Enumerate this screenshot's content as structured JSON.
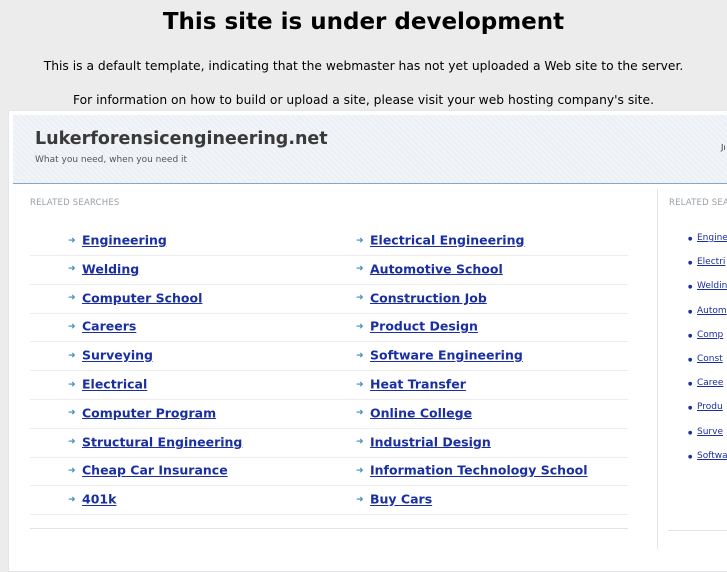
{
  "notice": {
    "title": "This site is under development",
    "line1": "This is a default template, indicating that the webmaster has not yet uploaded a Web site to the server.",
    "line2": "For information on how to build or upload a site, please visit your web hosting company's site."
  },
  "header": {
    "site_title": "Lukerforensicengineering.net",
    "tagline": "What you need, when you need it",
    "right_fragment": "Jı"
  },
  "main": {
    "section_label": "RELATED SEARCHES",
    "rows": [
      [
        "Engineering",
        "Electrical Engineering"
      ],
      [
        "Welding",
        "Automotive School"
      ],
      [
        "Computer School",
        "Construction Job"
      ],
      [
        "Careers",
        "Product Design"
      ],
      [
        "Surveying",
        "Software Engineering"
      ],
      [
        "Electrical",
        "Heat Transfer"
      ],
      [
        "Computer Program",
        "Online College"
      ],
      [
        "Structural Engineering",
        "Industrial Design"
      ],
      [
        "Cheap Car Insurance",
        "Information Technology School"
      ],
      [
        "401k",
        "Buy Cars"
      ]
    ]
  },
  "side": {
    "section_label": "RELATED SEA",
    "items": [
      "Engine",
      "Electri",
      "Weldin",
      "Autom",
      "Comp",
      "Const",
      "Caree",
      "Produ",
      "Surve",
      "Softwa"
    ]
  },
  "colors": {
    "link": "#1a2fa0",
    "arrow": "#3e8fb8",
    "header_border": "#7ea8d0"
  }
}
